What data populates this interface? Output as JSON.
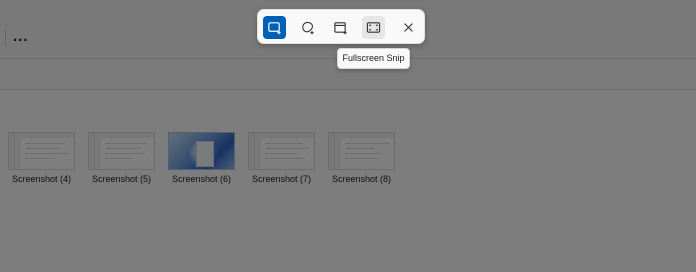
{
  "explorer": {
    "more_label": "...",
    "files": [
      {
        "name": "Screenshot (4)",
        "thumb": "explorer-window"
      },
      {
        "name": "Screenshot (5)",
        "thumb": "explorer-window"
      },
      {
        "name": "Screenshot (6)",
        "thumb": "windows-desktop"
      },
      {
        "name": "Screenshot (7)",
        "thumb": "explorer-window"
      },
      {
        "name": "Screenshot (8)",
        "thumb": "explorer-window"
      }
    ]
  },
  "snip_toolbar": {
    "modes": [
      {
        "icon": "rectangle-snip-icon",
        "state": "selected"
      },
      {
        "icon": "freeform-snip-icon",
        "state": "normal"
      },
      {
        "icon": "window-snip-icon",
        "state": "normal"
      },
      {
        "icon": "fullscreen-snip-icon",
        "state": "hover"
      }
    ],
    "close_icon": "close-icon",
    "tooltip": "Fullscreen Snip"
  },
  "colors": {
    "accent": "#005fb8",
    "overlay": "rgba(0,0,0,0.5)"
  }
}
